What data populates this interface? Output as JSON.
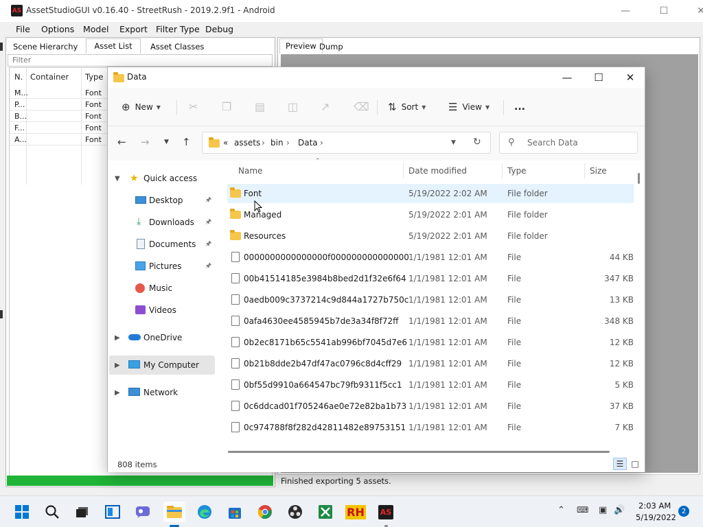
{
  "app": {
    "title": "AssetStudioGUI v0.16.40 - StreetRush - 2019.2.9f1 - Android",
    "logo_text": "AS",
    "menu": [
      "File",
      "Options",
      "Model",
      "Export",
      "Filter Type",
      "Debug"
    ],
    "tabs": [
      "Scene Hierarchy",
      "Asset List",
      "Asset Classes"
    ],
    "filter_placeholder": "Filter",
    "columns": [
      "N.",
      "Container",
      "Type"
    ],
    "rows": [
      {
        "name": "M...",
        "type": "Font"
      },
      {
        "name": "P...",
        "type": "Font"
      },
      {
        "name": "B...",
        "type": "Font"
      },
      {
        "name": "F...",
        "type": "Font"
      },
      {
        "name": "A...",
        "type": "Font"
      }
    ],
    "preview_tabs": [
      "Preview",
      "Dump"
    ],
    "status": "Finished exporting 5 assets."
  },
  "explorer": {
    "title": "Data",
    "commands": {
      "new": "New",
      "sort": "Sort",
      "view": "View",
      "more": "..."
    },
    "address": {
      "overflow": "«",
      "crumbs": [
        "assets",
        "bin",
        "Data"
      ]
    },
    "search_placeholder": "Search Data",
    "sidebar": [
      {
        "label": "Quick access",
        "icon": "star-icon",
        "indent": 0
      },
      {
        "label": "Desktop",
        "icon": "desktop-icon",
        "indent": 1,
        "pinned": true
      },
      {
        "label": "Downloads",
        "icon": "download-icon",
        "indent": 1,
        "pinned": true
      },
      {
        "label": "Documents",
        "icon": "document-icon",
        "indent": 1,
        "pinned": true
      },
      {
        "label": "Pictures",
        "icon": "picture-icon",
        "indent": 1,
        "pinned": true
      },
      {
        "label": "Music",
        "icon": "music-icon",
        "indent": 1
      },
      {
        "label": "Videos",
        "icon": "video-icon",
        "indent": 1
      },
      {
        "label": "OneDrive",
        "icon": "cloud-icon",
        "indent": 0
      },
      {
        "label": "My Computer",
        "icon": "computer-icon",
        "indent": 0,
        "selected": true
      },
      {
        "label": "Network",
        "icon": "network-icon",
        "indent": 0
      }
    ],
    "columns": {
      "name": "Name",
      "date": "Date modified",
      "type": "Type",
      "size": "Size"
    },
    "files": [
      {
        "name": "Font",
        "date": "5/19/2022 2:02 AM",
        "type": "File folder",
        "size": "",
        "folder": true
      },
      {
        "name": "Managed",
        "date": "5/19/2022 2:01 AM",
        "type": "File folder",
        "size": "",
        "folder": true
      },
      {
        "name": "Resources",
        "date": "5/19/2022 2:01 AM",
        "type": "File folder",
        "size": "",
        "folder": true
      },
      {
        "name": "0000000000000000f000000000000000",
        "date": "1/1/1981 12:01 AM",
        "type": "File",
        "size": "44 KB"
      },
      {
        "name": "00b41514185e3984b8bed2d1f32e6f64",
        "date": "1/1/1981 12:01 AM",
        "type": "File",
        "size": "347 KB"
      },
      {
        "name": "0aedb009c3737214c9d844a1727b750c",
        "date": "1/1/1981 12:01 AM",
        "type": "File",
        "size": "13 KB"
      },
      {
        "name": "0afa4630ee4585945b7de3a34f8f72ff",
        "date": "1/1/1981 12:01 AM",
        "type": "File",
        "size": "348 KB"
      },
      {
        "name": "0b2ec8171b65c5541ab996bf7045d7e6",
        "date": "1/1/1981 12:01 AM",
        "type": "File",
        "size": "12 KB"
      },
      {
        "name": "0b21b8dde2b47df47ac0796c8d4cff29",
        "date": "1/1/1981 12:01 AM",
        "type": "File",
        "size": "12 KB"
      },
      {
        "name": "0bf55d9910a664547bc79fb9311f5cc1",
        "date": "1/1/1981 12:01 AM",
        "type": "File",
        "size": "5 KB"
      },
      {
        "name": "0c6ddcad01f705246ae0e72e82ba1b73",
        "date": "1/1/1981 12:01 AM",
        "type": "File",
        "size": "37 KB"
      },
      {
        "name": "0c974788f8f282d42811482e89753151",
        "date": "1/1/1981 12:01 AM",
        "type": "File",
        "size": "7 KB"
      }
    ],
    "item_count": "808 items"
  },
  "taskbar": {
    "time": "2:03 AM",
    "date": "5/19/2022",
    "notifications": "2",
    "pinned_labels": {
      "rh": "RH",
      "as": "AS"
    }
  },
  "colors": {
    "accent": "#0067c0",
    "progress": "#1fb437",
    "selection": "#e5f3ff",
    "folder": "#f6c64a"
  }
}
